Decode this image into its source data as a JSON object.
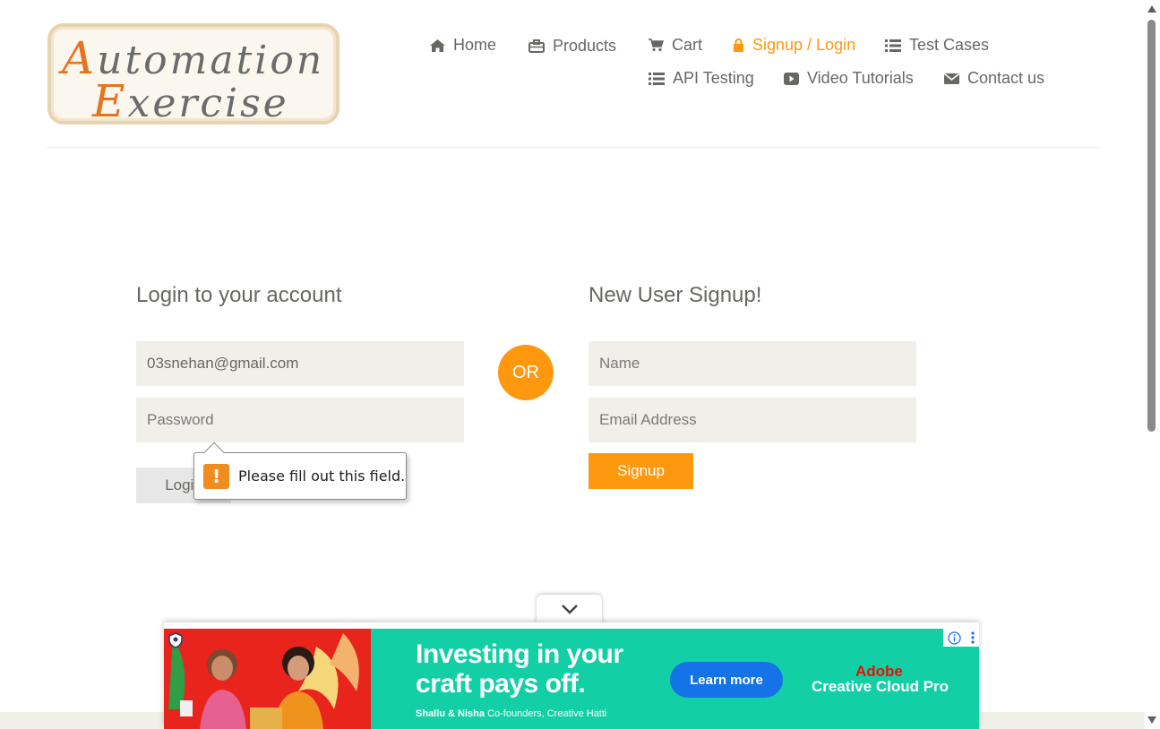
{
  "logo": {
    "line1_cap": "A",
    "line1_rest": "utomation",
    "line2_cap": "E",
    "line2_rest": "xercise"
  },
  "nav": {
    "home": "Home",
    "products": "Products",
    "cart": "Cart",
    "signup_login": "Signup / Login",
    "test_cases": "Test Cases",
    "api_testing": "API Testing",
    "video_tutorials": "Video Tutorials",
    "contact_us": "Contact us",
    "active_color": "#fe980f"
  },
  "login": {
    "title": "Login to your account",
    "email_value": "03snehan@gmail.com",
    "password_placeholder": "Password",
    "button": "Login"
  },
  "divider_text": "OR",
  "signup": {
    "title": "New User Signup!",
    "name_placeholder": "Name",
    "email_placeholder": "Email Address",
    "button": "Signup"
  },
  "tooltip": {
    "icon": "!",
    "message": "Please fill out this field."
  },
  "ad": {
    "headline_line1": "Investing in your",
    "headline_line2": "craft pays off.",
    "sub_names": "Shallu & Nisha",
    "sub_role": " Co-founders, Creative Hatti",
    "cta": "Learn more",
    "brand_line1": "Adobe",
    "brand_line2": "Creative Cloud Pro",
    "bg_color": "#13cfa6"
  }
}
